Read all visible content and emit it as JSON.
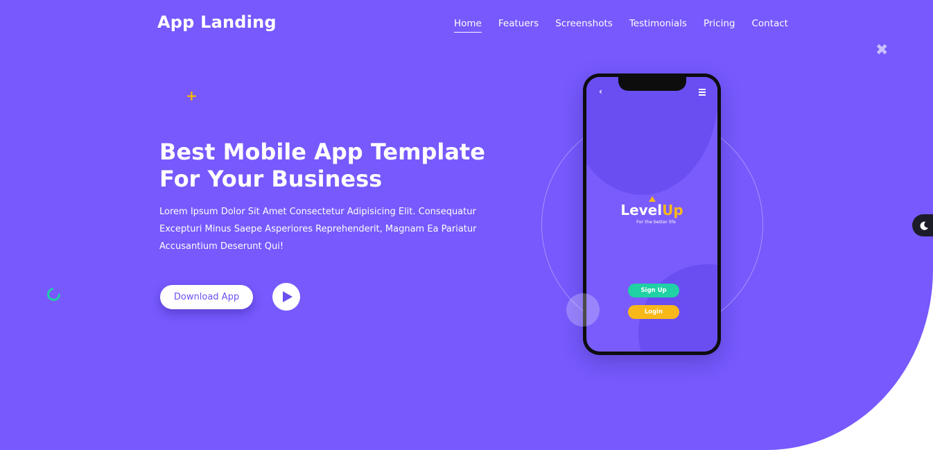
{
  "header": {
    "logo": "App Landing",
    "nav": [
      {
        "label": "Home",
        "active": true
      },
      {
        "label": "Featuers"
      },
      {
        "label": "Screenshots"
      },
      {
        "label": "Testimonials"
      },
      {
        "label": "Pricing"
      },
      {
        "label": "Contact"
      }
    ]
  },
  "hero": {
    "title": "Best Mobile App Template For Your Business",
    "subtitle": "Lorem Ipsum Dolor Sit Amet Consectetur Adipisicing Elit. Consequatur Excepturi Minus Saepe Asperiores Reprehenderit, Magnam Ea Pariatur Accusantium Deserunt Qui!",
    "download_label": "Download App",
    "play_icon": "play-icon"
  },
  "phone": {
    "brand_main": "Level",
    "brand_accent": "Up",
    "tagline": "For the better life",
    "signup_label": "Sign Up",
    "login_label": "Login"
  },
  "colors": {
    "hero_bg": "#7759fd",
    "accent_green": "#1fd1a4",
    "accent_yellow": "#f9b81a",
    "dark_toggle": "#1c1c28"
  },
  "icons": {
    "dark_mode": "moon-icon",
    "back": "chevron-left-icon",
    "menu": "hamburger-icon"
  }
}
